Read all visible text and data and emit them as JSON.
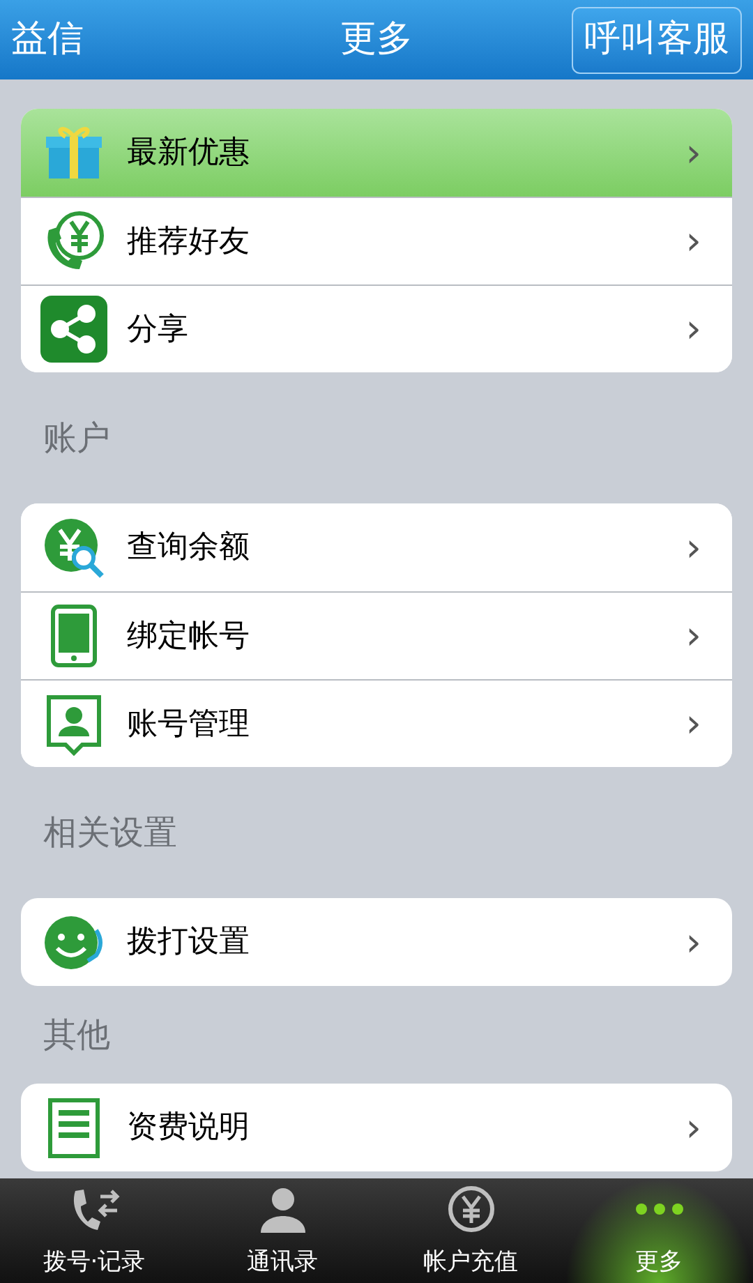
{
  "header": {
    "left": "益信",
    "title": "更多",
    "button": "呼叫客服"
  },
  "groups": [
    {
      "items": [
        {
          "label": "最新优惠",
          "kind": "gift",
          "selected": true,
          "chevron": "›"
        },
        {
          "label": "推荐好友",
          "kind": "recommend",
          "selected": false,
          "chevron": "›"
        },
        {
          "label": "分享",
          "kind": "share",
          "selected": false,
          "chevron": "›"
        }
      ]
    },
    {
      "title": "账户",
      "items": [
        {
          "label": "查询余额",
          "kind": "balance",
          "selected": false,
          "chevron": "›"
        },
        {
          "label": "绑定帐号",
          "kind": "device",
          "selected": false,
          "chevron": "›"
        },
        {
          "label": "账号管理",
          "kind": "account",
          "selected": false,
          "chevron": "›"
        }
      ]
    },
    {
      "title": "相关设置",
      "items": [
        {
          "label": "拨打设置",
          "kind": "dial",
          "selected": false,
          "chevron": "›"
        }
      ]
    },
    {
      "title": "其他",
      "items": [
        {
          "label": "资费说明",
          "kind": "list",
          "selected": false,
          "chevron": "›"
        }
      ]
    }
  ],
  "tabs": [
    {
      "label": "拨号·记录",
      "kind": "phone",
      "selected": false
    },
    {
      "label": "通讯录",
      "kind": "person",
      "selected": false
    },
    {
      "label": "帐户充值",
      "kind": "yen",
      "selected": false
    },
    {
      "label": "更多",
      "kind": "more",
      "selected": true
    }
  ]
}
